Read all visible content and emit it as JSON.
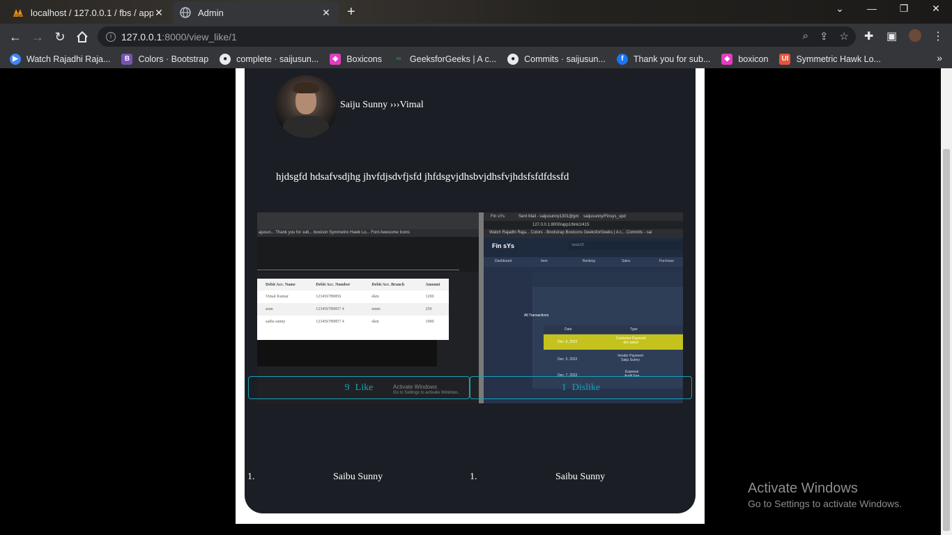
{
  "browser": {
    "tabs": [
      {
        "title": "localhost / 127.0.0.1 / fbs / app1",
        "active": false
      },
      {
        "title": "Admin",
        "active": true
      }
    ],
    "url_host": "127.0.0.1",
    "url_path": ":8000/view_like/1",
    "bookmarks": [
      {
        "label": "Watch Rajadhi Raja...",
        "icon": "play-icon",
        "color": "#4285f4"
      },
      {
        "label": "Colors · Bootstrap",
        "icon": "bootstrap-icon",
        "color": "#7952b3"
      },
      {
        "label": "complete · saijusun...",
        "icon": "github-icon",
        "color": "#e8eaed"
      },
      {
        "label": "Boxicons",
        "icon": "boxicons-icon",
        "color": "#e43dc2"
      },
      {
        "label": "GeeksforGeeks | A c...",
        "icon": "gfg-icon",
        "color": "#2f8d46"
      },
      {
        "label": "Commits · saijusun...",
        "icon": "github-icon",
        "color": "#e8eaed"
      },
      {
        "label": "Thank you for sub...",
        "icon": "facebook-icon",
        "color": "#1877f2"
      },
      {
        "label": "boxicon",
        "icon": "boxicons-icon",
        "color": "#e43dc2"
      },
      {
        "label": "Symmetric Hawk Lo...",
        "icon": "ui-icon",
        "color": "#e8543a"
      }
    ]
  },
  "post": {
    "poster": "Saiju Sunny ›››Vimal",
    "text": "hjdsgfd hdsafvsdjhg jhvfdjsdvfjsfd jhfdsgvjdhsbvjdhsfvjhdsfsfdfdssfd",
    "image": {
      "left_bookmarks": "ajusun...   Thank you for sub...   boxicon   Symmetric Hawk Lo...   Font Awesome Icons",
      "table_headers": [
        "Debit Acc. Name",
        "Debit Acc. Number",
        "Debit Acc. Branch",
        "Amount"
      ],
      "table_rows": [
        [
          "Vimal Kumar",
          "123456789856",
          "ekm",
          "1200"
        ],
        [
          "arun",
          "123456789857 4",
          "mnm",
          "250"
        ],
        [
          "saibu sunny",
          "123456789857 4",
          "ekm",
          "1000"
        ]
      ],
      "right_tab": "Fin sYs",
      "right_tab2": "Sent Mail - saijusunny1301@gm",
      "right_tab3": "saijusunny/Finsys_upd",
      "right_url": "127.0.0.1:8000/app1/bnk1/415",
      "right_bookmarks": "Watch Rajadhi Raja...   Colors - Bootstrap   Boxicons   GeeksforGeeks | A c...   Commits - sai",
      "logo": "Fin sYs",
      "search_placeholder": "search",
      "menu": [
        "Dashboard",
        "Item",
        "Banking",
        "Sales",
        "Purchase"
      ],
      "section_title": "All Transactions",
      "col_date": "Date",
      "col_type": "Type",
      "rows": [
        {
          "date": "Dec. 6, 2022",
          "type": "Customer Payment",
          "sub": "dev adam"
        },
        {
          "date": "Dec. 5, 2022",
          "type": "Vendor Payment",
          "sub": "Saiju Sunny"
        },
        {
          "date": "Dec. 7, 2022",
          "type": "Expense",
          "sub": "Audit Fee"
        }
      ],
      "activate_title": "Activate Windows",
      "activate_sub": "Go to Settings to activate Windows."
    }
  },
  "like": {
    "count": "9",
    "label": "Like"
  },
  "dislike": {
    "count": "1",
    "label": "Dislike"
  },
  "likers": [
    {
      "index": "1.",
      "name": "Saibu Sunny"
    }
  ],
  "dislikers": [
    {
      "index": "1.",
      "name": "Saibu Sunny"
    }
  ],
  "watermark": {
    "title": "Activate Windows",
    "subtitle": "Go to Settings to activate Windows."
  }
}
